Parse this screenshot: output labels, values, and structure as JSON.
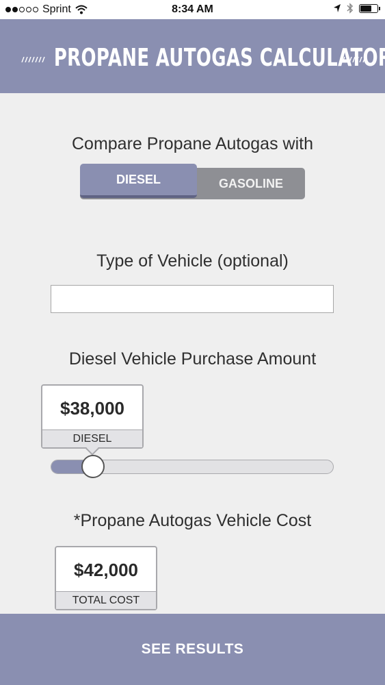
{
  "status_bar": {
    "carrier": "Sprint",
    "time": "8:34 AM",
    "signal_dots_filled": 2,
    "signal_dots_total": 5,
    "battery_level": 0.6
  },
  "header": {
    "title": "PROPANE AUTOGAS CALCULATOR",
    "color": "#8a8fb1"
  },
  "compare": {
    "label": "Compare Propane Autogas with",
    "options": [
      "DIESEL",
      "GASOLINE"
    ],
    "selected": "DIESEL"
  },
  "vehicle_type": {
    "label": "Type of Vehicle (optional)",
    "value": "",
    "placeholder": ""
  },
  "purchase": {
    "label": "Diesel Vehicle Purchase Amount",
    "amount": "$38,000",
    "tag": "DIESEL",
    "slider_fraction": 0.15
  },
  "propane_cost": {
    "label": "*Propane Autogas Vehicle Cost",
    "amount": "$42,000",
    "tag": "TOTAL COST"
  },
  "footer": {
    "button_label": "SEE RESULTS"
  }
}
